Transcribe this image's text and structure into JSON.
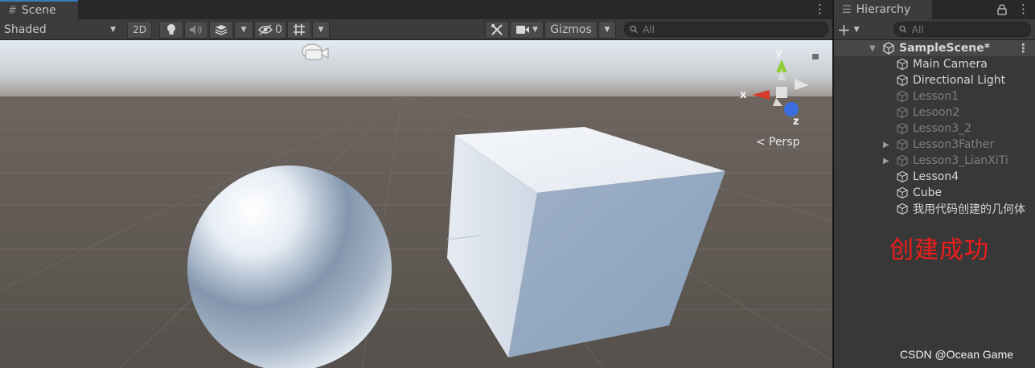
{
  "scene_tab": {
    "title": "Scene",
    "icon": "grid-icon"
  },
  "hierarchy_tab": {
    "title": "Hierarchy",
    "icon": "list-icon"
  },
  "scene_toolbar": {
    "shading_mode": "Shaded",
    "toggle_2d": "2D",
    "hidden_count": "0",
    "gizmos_label": "Gizmos",
    "search_placeholder": "All"
  },
  "scene_view": {
    "projection_label": "Persp",
    "axes": {
      "x": "x",
      "y": "y",
      "z": "z"
    },
    "colors": {
      "sky": "#dfe6ee",
      "ground": "#5b534d",
      "x_axis": "#d63a2a",
      "y_axis": "#8fcd3a",
      "z_axis": "#3b6fe0"
    }
  },
  "hierarchy_toolbar": {
    "add_label": "+",
    "search_placeholder": "All"
  },
  "hierarchy": {
    "scene_name": "SampleScene*",
    "items": [
      {
        "label": "Main Camera",
        "active": true,
        "has_children": false
      },
      {
        "label": "Directional Light",
        "active": true,
        "has_children": false
      },
      {
        "label": "Lesson1",
        "active": false,
        "has_children": false
      },
      {
        "label": "Lesoon2",
        "active": false,
        "has_children": false
      },
      {
        "label": "Lesson3_2",
        "active": false,
        "has_children": false
      },
      {
        "label": "Lesson3Father",
        "active": false,
        "has_children": true
      },
      {
        "label": "Lesson3_LianXiTi",
        "active": false,
        "has_children": true
      },
      {
        "label": "Lesson4",
        "active": true,
        "has_children": false
      },
      {
        "label": "Cube",
        "active": true,
        "has_children": false
      },
      {
        "label": "我用代码创建的几何体",
        "active": true,
        "has_children": false
      }
    ]
  },
  "annotation": {
    "text": "创建成功",
    "color": "#f01c1c"
  },
  "watermark": "CSDN @Ocean Game"
}
